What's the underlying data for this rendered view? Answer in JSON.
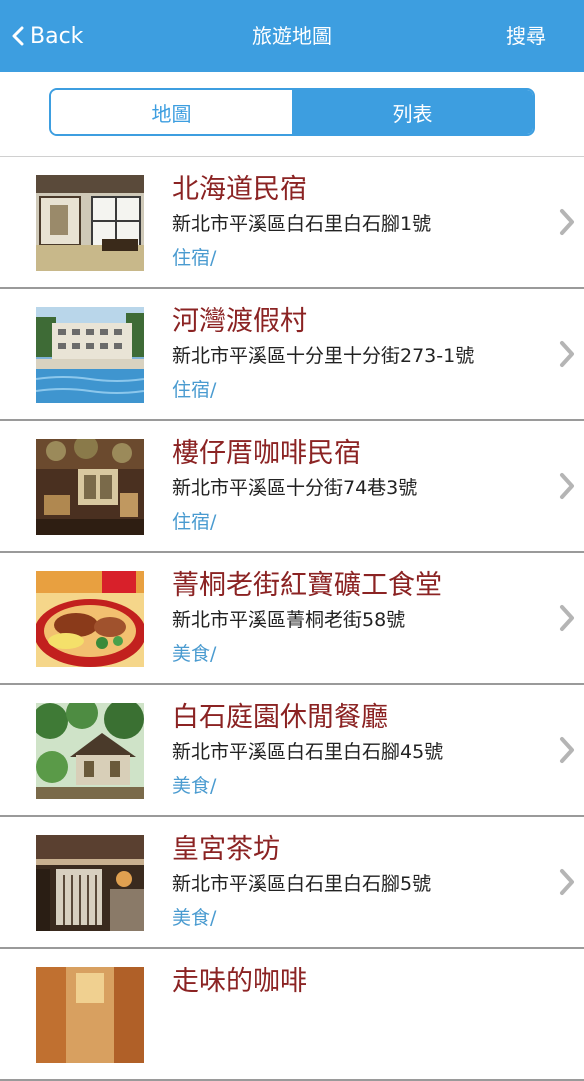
{
  "nav": {
    "back_label": "Back",
    "title": "旅遊地圖",
    "search_label": "搜尋"
  },
  "segment": {
    "map_label": "地圖",
    "list_label": "列表",
    "selected": "列表"
  },
  "items": [
    {
      "name": "北海道民宿",
      "address": "新北市平溪區白石里白石腳1號",
      "category": "住宿/"
    },
    {
      "name": "河灣渡假村",
      "address": "新北市平溪區十分里十分街273-1號",
      "category": "住宿/"
    },
    {
      "name": "樓仔厝咖啡民宿",
      "address": "新北市平溪區十分街74巷3號",
      "category": "住宿/"
    },
    {
      "name": "菁桐老街紅寶礦工食堂",
      "address": "新北市平溪區菁桐老街58號",
      "category": "美食/"
    },
    {
      "name": "白石庭園休閒餐廳",
      "address": "新北市平溪區白石里白石腳45號",
      "category": "美食/"
    },
    {
      "name": "皇宮茶坊",
      "address": "新北市平溪區白石里白石腳5號",
      "category": "美食/"
    },
    {
      "name": "走味的咖啡",
      "address": "",
      "category": ""
    }
  ],
  "colors": {
    "accent": "#3d9ee0",
    "title_text": "#8b2323",
    "category_text": "#4a9bd0"
  }
}
